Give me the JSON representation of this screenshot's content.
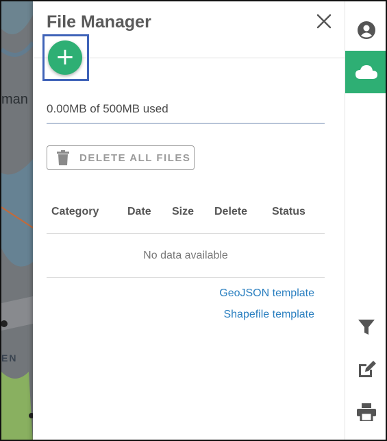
{
  "panel": {
    "title": "File Manager",
    "usage_text": "0.00MB of 500MB used",
    "delete_all_label": "DELETE ALL FILES",
    "table": {
      "columns": [
        "Category",
        "Date",
        "Size",
        "Delete",
        "Status"
      ],
      "empty_text": "No data available"
    },
    "links": {
      "geojson": "GeoJSON template",
      "shapefile": "Shapefile template"
    },
    "add_icon_glyph": "+"
  },
  "map_labels": {
    "partial_1": "man",
    "partial_2": "EN"
  },
  "toolbar": {
    "items": [
      {
        "icon": "account-icon",
        "active": false
      },
      {
        "icon": "cloud-icon",
        "active": true
      },
      {
        "icon": "filter-icon",
        "active": false
      },
      {
        "icon": "edit-icon",
        "active": false
      },
      {
        "icon": "print-icon",
        "active": false
      }
    ]
  },
  "colors": {
    "accent": "#2eaf74",
    "link": "#2a7fc0",
    "highlight": "#3f63b8"
  }
}
